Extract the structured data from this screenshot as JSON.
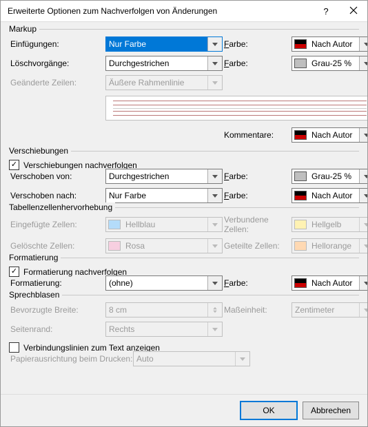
{
  "title": "Erweiterte Optionen zum Nachverfolgen von Änderungen",
  "groups": {
    "markup": "Markup",
    "versch": "Verschiebungen",
    "tab": "Tabellenzellenhervorhebung",
    "format": "Formatierung",
    "blasen": "Sprechblasen"
  },
  "labels": {
    "einfug": "Einfügungen:",
    "losch": "Löschvorgänge:",
    "geandert": "Geänderte Zeilen:",
    "kommentare": "Kommentare:",
    "farbe": "Farbe:",
    "verschChk": "Verschiebungen nachverfolgen",
    "verschVon": "Verschoben von:",
    "verschNach": "Verschoben nach:",
    "eingZ": "Eingefügte Zellen:",
    "gelZ": "Gelöschte Zellen:",
    "verbZ": "Verbundene Zellen:",
    "getZ": "Geteilte Zellen:",
    "formatChk": "Formatierung nachverfolgen",
    "formatierung": "Formatierung:",
    "bevBreite": "Bevorzugte Breite:",
    "mass": "Maßeinheit:",
    "seitenrand": "Seitenrand:",
    "verbLinien": "Verbindungslinien zum Text anzeigen",
    "papier": "Papierausrichtung beim Drucken:"
  },
  "values": {
    "einfug": "Nur Farbe",
    "losch": "Durchgestrichen",
    "geandert": "Äußere Rahmenlinie",
    "kommentare": "Nach Autor",
    "farbeEinf": "Nach Autor",
    "farbeLosch": "Grau-25 %",
    "verschVon": "Durchgestrichen",
    "verschNach": "Nur Farbe",
    "farbeVerschVon": "Grau-25 %",
    "farbeVerschNach": "Nach Autor",
    "eingZ": "Hellblau",
    "gelZ": "Rosa",
    "verbZ": "Hellgelb",
    "getZ": "Hellorange",
    "formatierung": "(ohne)",
    "farbeFormat": "Nach Autor",
    "bevBreite": "8 cm",
    "mass": "Zentimeter",
    "seitenrand": "Rechts",
    "papier": "Auto"
  },
  "checks": {
    "versch": true,
    "format": true,
    "verbLinien": false
  },
  "buttons": {
    "ok": "OK",
    "cancel": "Abbrechen"
  }
}
